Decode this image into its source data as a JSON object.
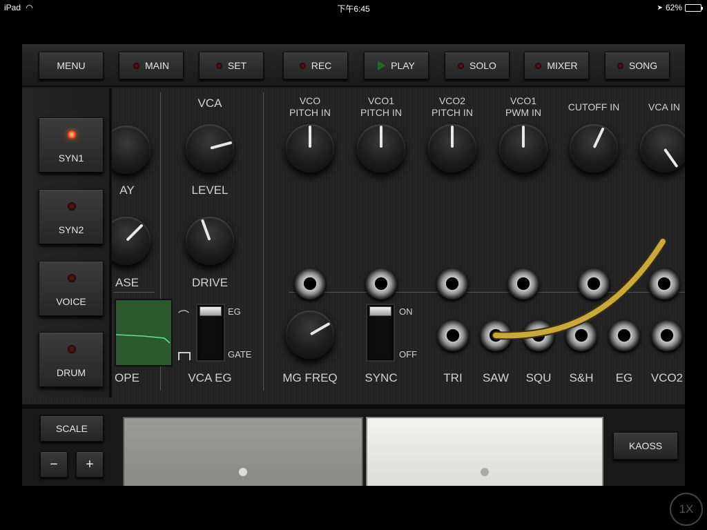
{
  "status_bar": {
    "device": "iPad",
    "time": "下午6:45",
    "battery": "62%",
    "battery_level": 0.62
  },
  "top_buttons": [
    {
      "label": "MENU",
      "led": false,
      "kind": "plain"
    },
    {
      "label": "MAIN",
      "led": false,
      "kind": "led"
    },
    {
      "label": "SET",
      "led": false,
      "kind": "led"
    },
    {
      "label": "REC",
      "led": false,
      "kind": "led"
    },
    {
      "label": "PLAY",
      "led": false,
      "kind": "play"
    },
    {
      "label": "SOLO",
      "led": false,
      "kind": "led"
    },
    {
      "label": "MIXER",
      "led": false,
      "kind": "led"
    },
    {
      "label": "SONG",
      "led": false,
      "kind": "led"
    }
  ],
  "side_buttons": [
    {
      "label": "SYN1",
      "led_on": true
    },
    {
      "label": "SYN2",
      "led_on": false
    },
    {
      "label": "VOICE",
      "led_on": false
    },
    {
      "label": "DRUM",
      "led_on": false
    }
  ],
  "partial_labels": {
    "delay": "AY",
    "phase": "ASE",
    "scope": "OPE"
  },
  "vca": {
    "title": "VCA",
    "level": "LEVEL",
    "drive": "DRIVE",
    "eg_label": "EG",
    "gate_label": "GATE",
    "vca_eg": "VCA EG"
  },
  "patch_inputs": [
    {
      "line1": "VCO",
      "line2": "PITCH IN"
    },
    {
      "line1": "VCO1",
      "line2": "PITCH IN"
    },
    {
      "line1": "VCO2",
      "line2": "PITCH IN"
    },
    {
      "line1": "VCO1",
      "line2": "PWM IN"
    },
    {
      "line1": "CUTOFF IN",
      "line2": ""
    },
    {
      "line1": "VCA IN",
      "line2": ""
    }
  ],
  "mg": {
    "freq": "MG FREQ",
    "sync": "SYNC",
    "on": "ON",
    "off": "OFF"
  },
  "outputs": [
    "TRI",
    "SAW",
    "SQU",
    "S&H",
    "EG",
    "VCO2"
  ],
  "bottom": {
    "scale": "SCALE",
    "minus": "−",
    "plus": "+",
    "kaoss": "KAOSS"
  },
  "zoom": "1X",
  "colors": {
    "cable": "#c9a93a",
    "led_on": "#ff5a1a",
    "scope_bg": "#2b5a2f"
  }
}
